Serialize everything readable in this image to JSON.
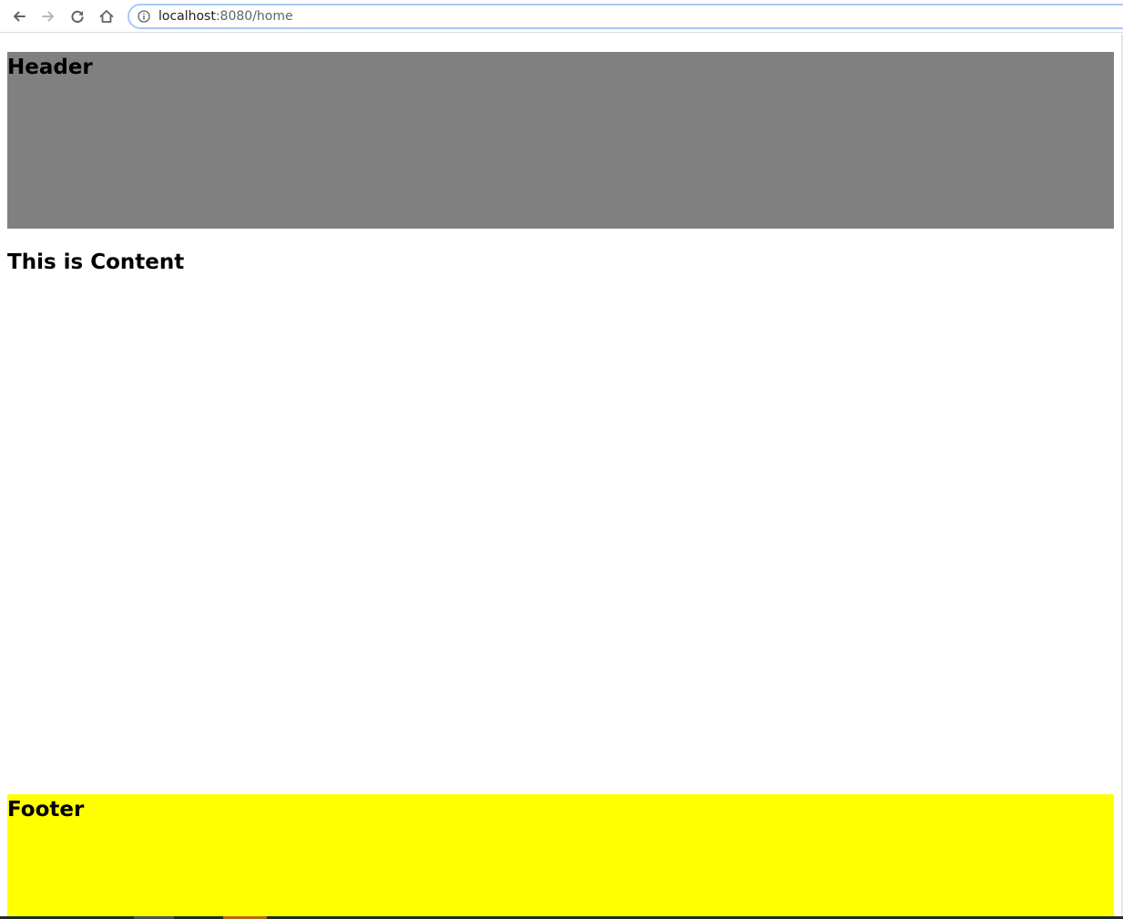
{
  "browser": {
    "url_host": "localhost",
    "url_rest": ":8080/home",
    "icons": {
      "back": "arrow-left-icon",
      "forward": "arrow-right-icon",
      "reload": "reload-icon",
      "home": "home-icon",
      "site_info": "info-icon"
    }
  },
  "page": {
    "header": {
      "title": "Header",
      "background": "#808080"
    },
    "content": {
      "heading": "This is Content"
    },
    "footer": {
      "title": "Footer",
      "background": "#ffff00"
    }
  }
}
